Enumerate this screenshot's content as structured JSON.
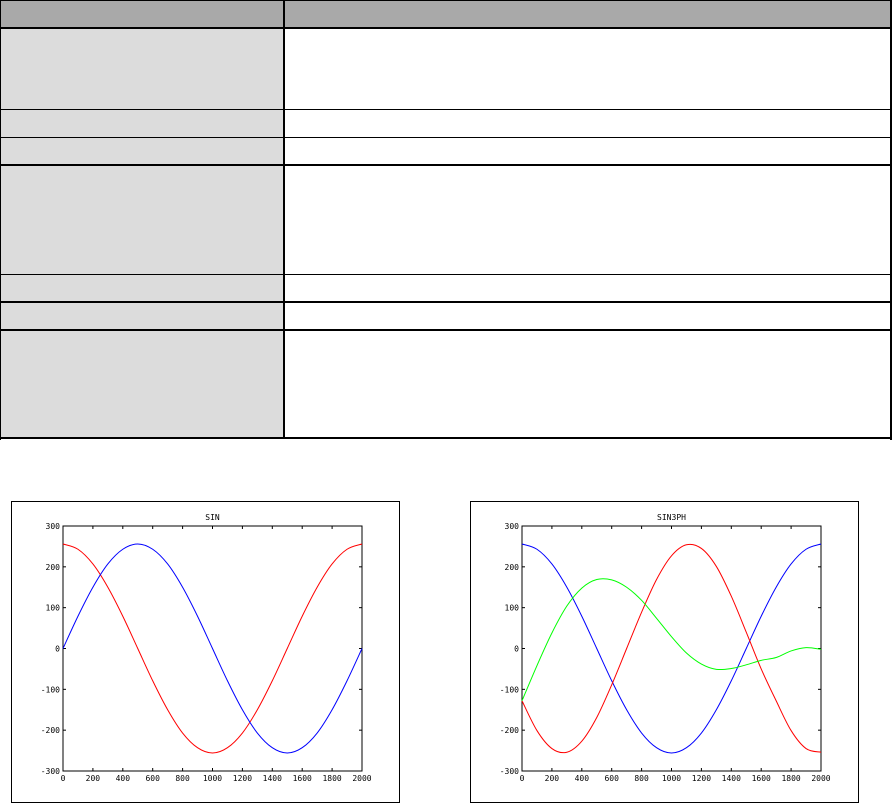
{
  "chart_data": [
    {
      "type": "line",
      "title": "SIN",
      "xlabel": "",
      "ylabel": "",
      "xlim": [
        0,
        2000
      ],
      "ylim": [
        -300,
        300
      ],
      "x_ticks": [
        "0",
        "200",
        "400",
        "600",
        "800",
        "1000",
        "1200",
        "1400",
        "1600",
        "1800",
        "2000"
      ],
      "y_ticks": [
        "300",
        "200",
        "100",
        "0",
        "-100",
        "-200",
        "-300"
      ],
      "grid": false,
      "series": [
        {
          "color": "#ff0000",
          "x": [
            0,
            100,
            200,
            300,
            400,
            500,
            600,
            700,
            800,
            900,
            1000,
            1100,
            1200,
            1300,
            1400,
            1500,
            1600,
            1700,
            1800,
            1900,
            2000
          ],
          "y": [
            256,
            243,
            207,
            150,
            79,
            0,
            -79,
            -150,
            -207,
            -243,
            -256,
            -243,
            -207,
            -150,
            -79,
            0,
            79,
            150,
            207,
            243,
            256
          ]
        },
        {
          "color": "#0000ff",
          "x": [
            0,
            100,
            200,
            300,
            400,
            500,
            600,
            700,
            800,
            900,
            1000,
            1100,
            1200,
            1300,
            1400,
            1500,
            1600,
            1700,
            1800,
            1900,
            2000
          ],
          "y": [
            0,
            79,
            150,
            207,
            243,
            256,
            243,
            207,
            150,
            79,
            0,
            -79,
            -150,
            -207,
            -243,
            -256,
            -243,
            -207,
            -150,
            -79,
            0
          ]
        }
      ]
    },
    {
      "type": "line",
      "title": "SIN3PH",
      "xlabel": "",
      "ylabel": "",
      "xlim": [
        0,
        2000
      ],
      "ylim": [
        -300,
        300
      ],
      "x_ticks": [
        "0",
        "200",
        "400",
        "600",
        "800",
        "1000",
        "1200",
        "1400",
        "1600",
        "1800",
        "2000"
      ],
      "y_ticks": [
        "300",
        "200",
        "100",
        "0",
        "-100",
        "-200",
        "-300"
      ],
      "grid": false,
      "series": [
        {
          "color": "#0000ff",
          "x": [
            0,
            100,
            200,
            300,
            400,
            500,
            600,
            700,
            800,
            900,
            1000,
            1100,
            1200,
            1300,
            1400,
            1500,
            1600,
            1700,
            1800,
            1900,
            2000
          ],
          "y": [
            256,
            243,
            207,
            150,
            79,
            0,
            -79,
            -150,
            -207,
            -243,
            -256,
            -243,
            -207,
            -150,
            -79,
            0,
            79,
            150,
            207,
            243,
            256
          ]
        },
        {
          "color": "#ff0000",
          "x": [
            0,
            100,
            200,
            300,
            400,
            500,
            600,
            700,
            800,
            900,
            1000,
            1100,
            1200,
            1300,
            1400,
            1500,
            1600,
            1700,
            1800,
            1900,
            2000
          ],
          "y": [
            -128,
            -201,
            -245,
            -254,
            -227,
            -169,
            -89,
            0,
            89,
            169,
            227,
            254,
            245,
            201,
            128,
            40,
            -50,
            -128,
            -201,
            -245,
            -254
          ]
        },
        {
          "color": "#00ff00",
          "x": [
            0,
            100,
            200,
            300,
            400,
            500,
            600,
            700,
            800,
            900,
            1000,
            1100,
            1200,
            1300,
            1400,
            1500,
            1600,
            1700,
            1800,
            1900,
            2000
          ],
          "y": [
            -128,
            -42,
            38,
            104,
            148,
            169,
            168,
            150,
            118,
            74,
            29,
            -11,
            -38,
            -51,
            -49,
            -40,
            -29,
            -22,
            -6,
            2,
            -2
          ]
        }
      ]
    }
  ]
}
